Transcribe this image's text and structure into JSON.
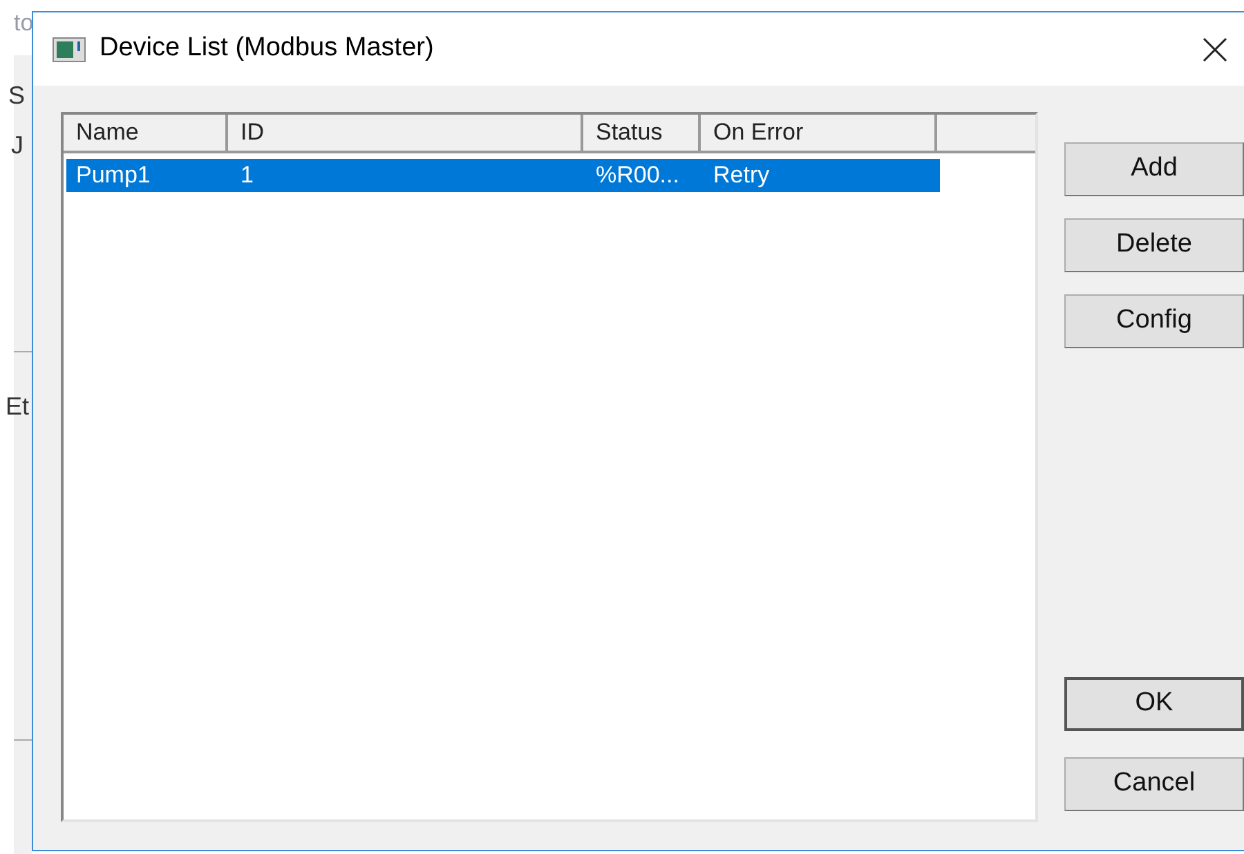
{
  "background_window": {
    "fragments": [
      "to",
      "S",
      "J",
      "Et"
    ]
  },
  "dialog": {
    "title": "Device List (Modbus Master)",
    "table": {
      "columns": [
        "Name",
        "ID",
        "Status",
        "On Error"
      ],
      "rows": [
        {
          "cells": [
            "Pump1",
            "1",
            "%R00...",
            "Retry"
          ],
          "selected": true
        }
      ]
    },
    "side_buttons": [
      {
        "label": "Add",
        "default": false
      },
      {
        "label": "Delete",
        "default": false
      },
      {
        "label": "Config",
        "default": false
      }
    ],
    "bottom_buttons": [
      {
        "label": "OK",
        "default": true
      },
      {
        "label": "Cancel",
        "default": false
      }
    ]
  }
}
